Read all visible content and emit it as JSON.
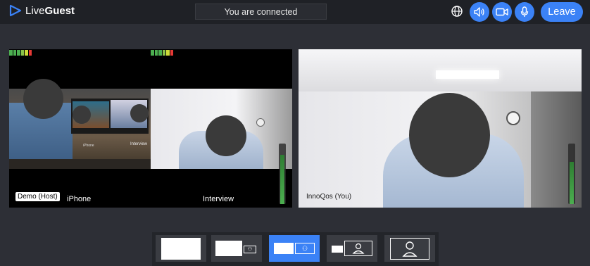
{
  "app": {
    "brand_light": "Live",
    "brand_bold": "Guest"
  },
  "status": {
    "text": "You are connected"
  },
  "toolbar": {
    "leave_label": "Leave"
  },
  "left_panel": {
    "host_tag": "Demo (Host)",
    "label_a": "iPhone",
    "label_b": "Interview",
    "screen_label": "Interview"
  },
  "right_panel": {
    "name": "InnoQos (You)"
  },
  "layout_options": [
    {
      "name": "single-large",
      "active": false
    },
    {
      "name": "large-with-small",
      "active": false
    },
    {
      "name": "side-by-side",
      "active": true
    },
    {
      "name": "small-with-large",
      "active": false
    },
    {
      "name": "person-only",
      "active": false
    }
  ],
  "colors": {
    "accent": "#3b82f6",
    "meter_green": "#4caf50",
    "meter_red": "#e53935"
  }
}
